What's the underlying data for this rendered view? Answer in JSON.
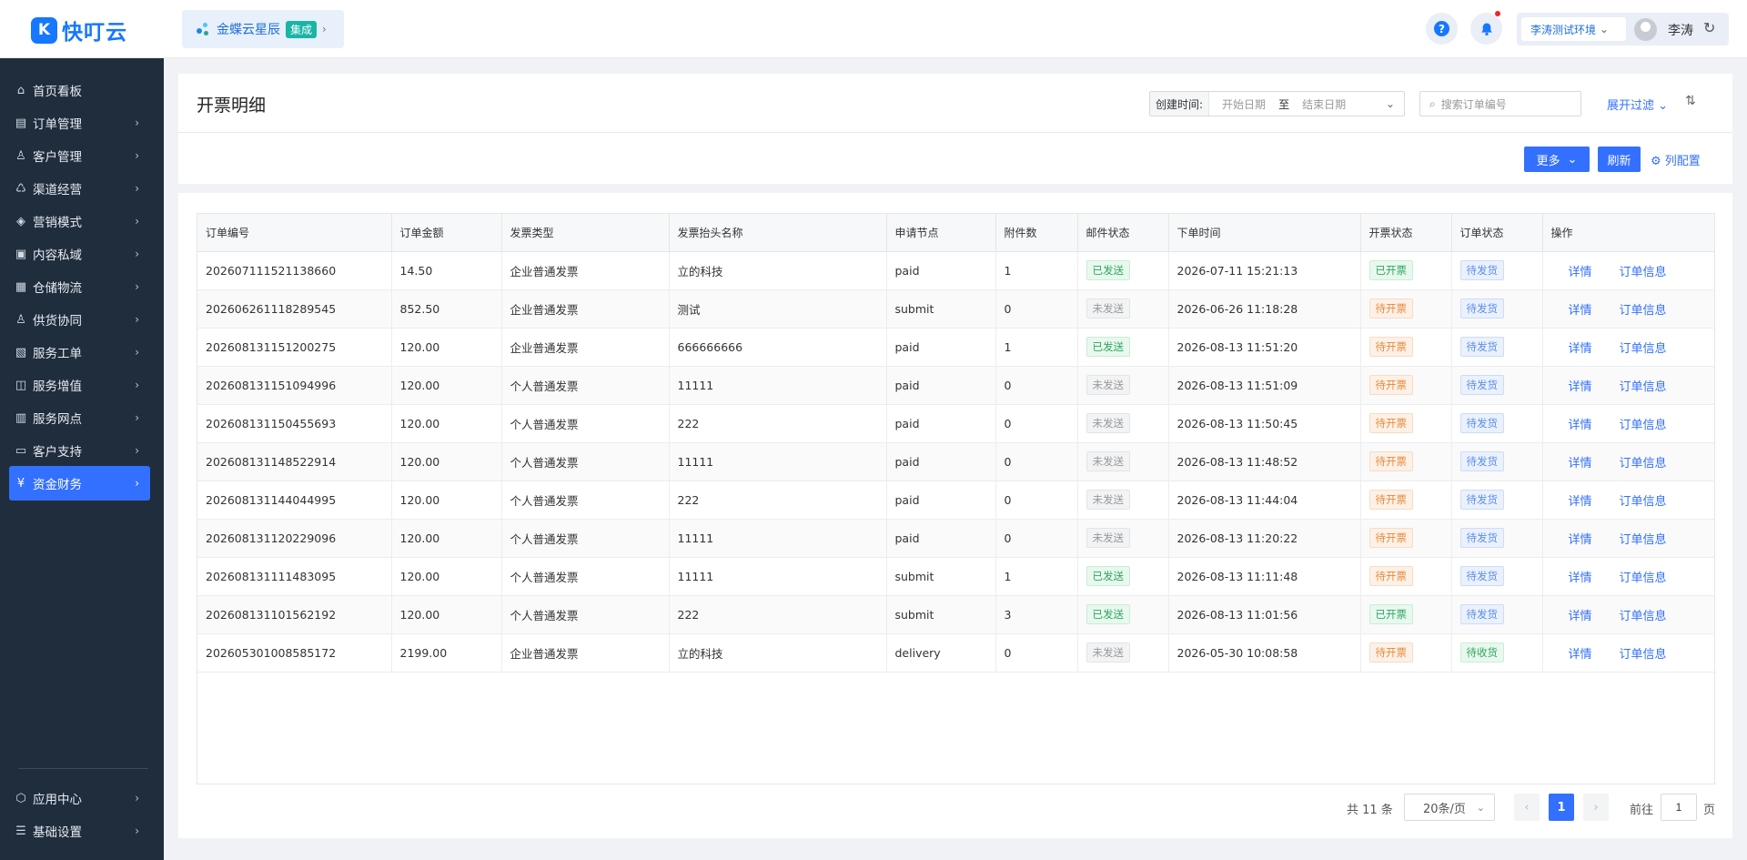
{
  "header": {
    "logo_mark": "K",
    "logo_text": "快叮云",
    "integration_name": "金蝶云星辰",
    "integration_badge": "集成",
    "help_glyph": "?",
    "env_label": "李涛测试环境",
    "user_name": "李涛"
  },
  "sidebar": {
    "items": [
      {
        "label": "首页看板",
        "icon": "home-icon",
        "glyph": "⌂",
        "has_arrow": false
      },
      {
        "label": "订单管理",
        "icon": "document-icon",
        "glyph": "▤",
        "has_arrow": true
      },
      {
        "label": "客户管理",
        "icon": "user-icon",
        "glyph": "♙",
        "has_arrow": true
      },
      {
        "label": "渠道经营",
        "icon": "channel-icon",
        "glyph": "♺",
        "has_arrow": true
      },
      {
        "label": "营销模式",
        "icon": "tag-icon",
        "glyph": "◈",
        "has_arrow": true
      },
      {
        "label": "内容私域",
        "icon": "image-icon",
        "glyph": "▣",
        "has_arrow": true
      },
      {
        "label": "仓储物流",
        "icon": "warehouse-icon",
        "glyph": "▦",
        "has_arrow": true
      },
      {
        "label": "供货协同",
        "icon": "supply-icon",
        "glyph": "♙",
        "has_arrow": true
      },
      {
        "label": "服务工单",
        "icon": "ticket-icon",
        "glyph": "▧",
        "has_arrow": true
      },
      {
        "label": "服务增值",
        "icon": "bag-icon",
        "glyph": "◫",
        "has_arrow": true
      },
      {
        "label": "服务网点",
        "icon": "store-icon",
        "glyph": "▥",
        "has_arrow": true
      },
      {
        "label": "客户支持",
        "icon": "support-icon",
        "glyph": "▭",
        "has_arrow": true
      },
      {
        "label": "资金财务",
        "icon": "finance-icon",
        "glyph": "¥",
        "has_arrow": true,
        "active": true
      }
    ],
    "bottom_items": [
      {
        "label": "应用中心",
        "icon": "app-center-icon",
        "glyph": "⬡",
        "has_arrow": true
      },
      {
        "label": "基础设置",
        "icon": "settings-list-icon",
        "glyph": "☰",
        "has_arrow": true
      }
    ]
  },
  "page": {
    "title": "开票明细",
    "filter": {
      "created_label": "创建时间:",
      "start_placeholder": "开始日期",
      "separator": "至",
      "end_placeholder": "结束日期",
      "search_placeholder": "搜索订单编号",
      "expand_filter": "展开过滤"
    },
    "toolbar": {
      "more": "更多",
      "refresh": "刷新",
      "column_config": "列配置"
    }
  },
  "table": {
    "columns": [
      "订单编号",
      "订单金额",
      "发票类型",
      "发票抬头名称",
      "申请节点",
      "附件数",
      "邮件状态",
      "下单时间",
      "开票状态",
      "订单状态",
      "操作"
    ],
    "rows": [
      {
        "order_no": "202607111521138660",
        "amount": "14.50",
        "invoice_type": "企业普通发票",
        "title": "立的科技",
        "node": "paid",
        "attachments": "1",
        "mail_status": "已发送",
        "mail_color": "green",
        "order_time": "2026-07-11 15:21:13",
        "invoice_status": "已开票",
        "invoice_color": "green",
        "order_status": "待发货",
        "order_color": "blue",
        "action_detail": "详情",
        "action_order": "订单信息"
      },
      {
        "order_no": "202606261118289545",
        "amount": "852.50",
        "invoice_type": "企业普通发票",
        "title": "测试",
        "node": "submit",
        "attachments": "0",
        "mail_status": "未发送",
        "mail_color": "grey",
        "order_time": "2026-06-26 11:18:28",
        "invoice_status": "待开票",
        "invoice_color": "orange",
        "order_status": "待发货",
        "order_color": "blue",
        "action_detail": "详情",
        "action_order": "订单信息"
      },
      {
        "order_no": "202608131151200275",
        "amount": "120.00",
        "invoice_type": "企业普通发票",
        "title": "666666666",
        "node": "paid",
        "attachments": "1",
        "mail_status": "已发送",
        "mail_color": "green",
        "order_time": "2026-08-13 11:51:20",
        "invoice_status": "待开票",
        "invoice_color": "orange",
        "order_status": "待发货",
        "order_color": "blue",
        "action_detail": "详情",
        "action_order": "订单信息"
      },
      {
        "order_no": "202608131151094996",
        "amount": "120.00",
        "invoice_type": "个人普通发票",
        "title": "11111",
        "node": "paid",
        "attachments": "0",
        "mail_status": "未发送",
        "mail_color": "grey",
        "order_time": "2026-08-13 11:51:09",
        "invoice_status": "待开票",
        "invoice_color": "orange",
        "order_status": "待发货",
        "order_color": "blue",
        "action_detail": "详情",
        "action_order": "订单信息"
      },
      {
        "order_no": "202608131150455693",
        "amount": "120.00",
        "invoice_type": "个人普通发票",
        "title": "222",
        "node": "paid",
        "attachments": "0",
        "mail_status": "未发送",
        "mail_color": "grey",
        "order_time": "2026-08-13 11:50:45",
        "invoice_status": "待开票",
        "invoice_color": "orange",
        "order_status": "待发货",
        "order_color": "blue",
        "action_detail": "详情",
        "action_order": "订单信息"
      },
      {
        "order_no": "202608131148522914",
        "amount": "120.00",
        "invoice_type": "个人普通发票",
        "title": "11111",
        "node": "paid",
        "attachments": "0",
        "mail_status": "未发送",
        "mail_color": "grey",
        "order_time": "2026-08-13 11:48:52",
        "invoice_status": "待开票",
        "invoice_color": "orange",
        "order_status": "待发货",
        "order_color": "blue",
        "action_detail": "详情",
        "action_order": "订单信息"
      },
      {
        "order_no": "202608131144044995",
        "amount": "120.00",
        "invoice_type": "个人普通发票",
        "title": "222",
        "node": "paid",
        "attachments": "0",
        "mail_status": "未发送",
        "mail_color": "grey",
        "order_time": "2026-08-13 11:44:04",
        "invoice_status": "待开票",
        "invoice_color": "orange",
        "order_status": "待发货",
        "order_color": "blue",
        "action_detail": "详情",
        "action_order": "订单信息"
      },
      {
        "order_no": "202608131120229096",
        "amount": "120.00",
        "invoice_type": "个人普通发票",
        "title": "11111",
        "node": "paid",
        "attachments": "0",
        "mail_status": "未发送",
        "mail_color": "grey",
        "order_time": "2026-08-13 11:20:22",
        "invoice_status": "待开票",
        "invoice_color": "orange",
        "order_status": "待发货",
        "order_color": "blue",
        "action_detail": "详情",
        "action_order": "订单信息"
      },
      {
        "order_no": "202608131111483095",
        "amount": "120.00",
        "invoice_type": "个人普通发票",
        "title": "11111",
        "node": "submit",
        "attachments": "1",
        "mail_status": "已发送",
        "mail_color": "green",
        "order_time": "2026-08-13 11:11:48",
        "invoice_status": "待开票",
        "invoice_color": "orange",
        "order_status": "待发货",
        "order_color": "blue",
        "action_detail": "详情",
        "action_order": "订单信息"
      },
      {
        "order_no": "202608131101562192",
        "amount": "120.00",
        "invoice_type": "个人普通发票",
        "title": "222",
        "node": "submit",
        "attachments": "3",
        "mail_status": "已发送",
        "mail_color": "green",
        "order_time": "2026-08-13 11:01:56",
        "invoice_status": "已开票",
        "invoice_color": "green",
        "order_status": "待发货",
        "order_color": "blue",
        "action_detail": "详情",
        "action_order": "订单信息"
      },
      {
        "order_no": "202605301008585172",
        "amount": "2199.00",
        "invoice_type": "企业普通发票",
        "title": "立的科技",
        "node": "delivery",
        "attachments": "0",
        "mail_status": "未发送",
        "mail_color": "grey",
        "order_time": "2026-05-30 10:08:58",
        "invoice_status": "待开票",
        "invoice_color": "orange",
        "order_status": "待收货",
        "order_color": "green",
        "action_detail": "详情",
        "action_order": "订单信息"
      }
    ]
  },
  "pagination": {
    "total_text": "共 11 条",
    "page_size": "20条/页",
    "current_page": "1",
    "goto_label": "前往",
    "goto_value": "1",
    "page_unit": "页"
  },
  "colors": {
    "primary": "#3370ff",
    "sidebar_bg": "#1f2d3d"
  }
}
